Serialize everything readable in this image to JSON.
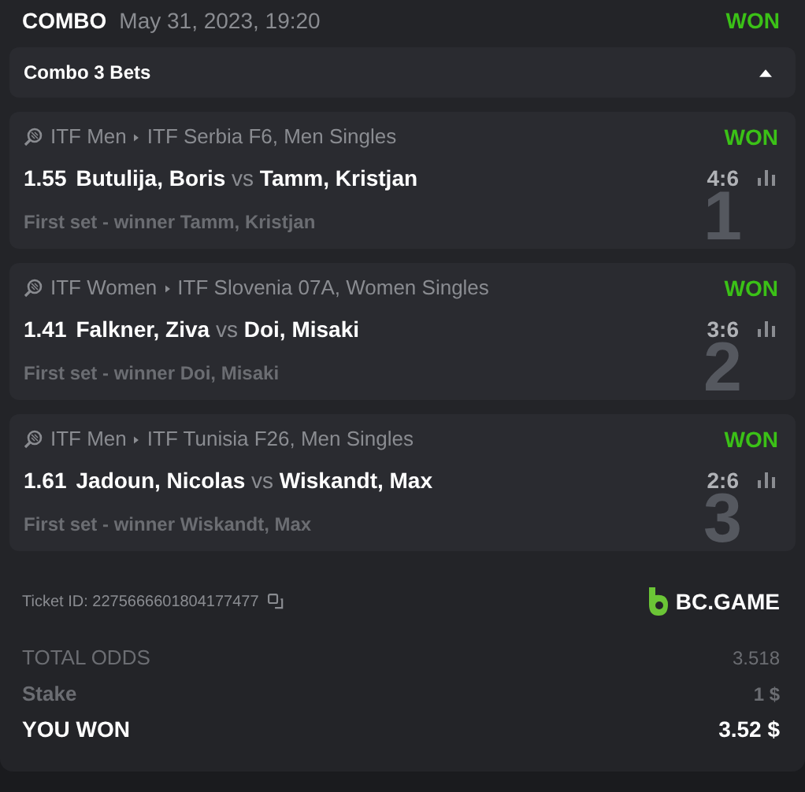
{
  "header": {
    "type": "COMBO",
    "date": "May 31, 2023, 19:20",
    "status": "WON"
  },
  "combo": {
    "title": "Combo 3 Bets",
    "expanded": true
  },
  "bets": [
    {
      "category": "ITF Men",
      "tournament": "ITF Serbia F6, Men Singles",
      "status": "WON",
      "odds": "1.55",
      "home": "Butulija, Boris",
      "vs": "vs",
      "away": "Tamm, Kristjan",
      "score": "4:6",
      "market": "First set - winner Tamm, Kristjan",
      "index": "1"
    },
    {
      "category": "ITF Women",
      "tournament": "ITF Slovenia 07A, Women Singles",
      "status": "WON",
      "odds": "1.41",
      "home": "Falkner, Ziva",
      "vs": "vs",
      "away": "Doi, Misaki",
      "score": "3:6",
      "market": "First set - winner Doi, Misaki",
      "index": "2"
    },
    {
      "category": "ITF Men",
      "tournament": "ITF Tunisia F26, Men Singles",
      "status": "WON",
      "odds": "1.61",
      "home": "Jadoun, Nicolas",
      "vs": "vs",
      "away": "Wiskandt, Max",
      "score": "2:6",
      "market": "First set - winner Wiskandt, Max",
      "index": "3"
    }
  ],
  "ticket": {
    "label": "Ticket ID: 2275666601804177477",
    "brand": "BC.GAME"
  },
  "summary": [
    {
      "kind": "plain",
      "label": "TOTAL ODDS",
      "value": "3.518"
    },
    {
      "kind": "bold",
      "label": "Stake",
      "value": "1 $"
    },
    {
      "kind": "total",
      "label": "YOU WON",
      "value": "3.52 $"
    }
  ]
}
